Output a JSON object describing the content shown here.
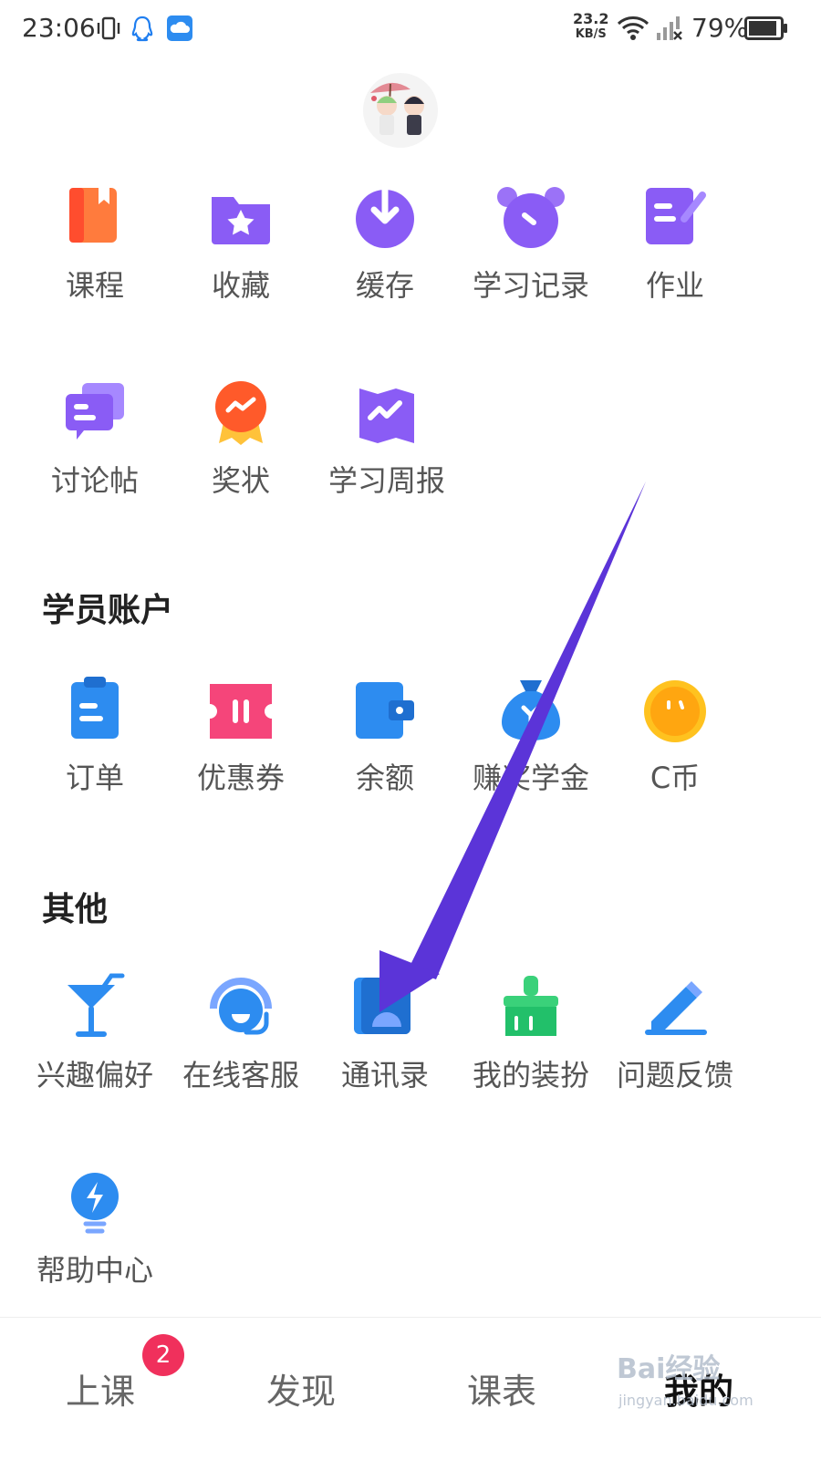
{
  "status_bar": {
    "time": "23:06",
    "speed_value": "23.2",
    "speed_unit": "KB/S",
    "battery": "79%"
  },
  "features": [
    {
      "label": "课程",
      "icon": "course-book-icon"
    },
    {
      "label": "收藏",
      "icon": "favorites-folder-icon"
    },
    {
      "label": "缓存",
      "icon": "cache-download-icon"
    },
    {
      "label": "学习记录",
      "icon": "study-record-clock-icon"
    },
    {
      "label": "作业",
      "icon": "homework-edit-icon"
    },
    {
      "label": "讨论帖",
      "icon": "discussion-chat-icon"
    },
    {
      "label": "奖状",
      "icon": "certificate-medal-icon"
    },
    {
      "label": "学习周报",
      "icon": "weekly-report-map-icon"
    }
  ],
  "account_section": {
    "title": "学员账户",
    "items": [
      {
        "label": "订单",
        "icon": "order-clipboard-icon"
      },
      {
        "label": "优惠券",
        "icon": "coupon-ticket-icon"
      },
      {
        "label": "余额",
        "icon": "balance-wallet-icon"
      },
      {
        "label": "赚奖学金",
        "icon": "scholarship-bag-icon"
      },
      {
        "label": "C币",
        "icon": "c-coin-icon"
      }
    ]
  },
  "other_section": {
    "title": "其他",
    "items": [
      {
        "label": "兴趣偏好",
        "icon": "interest-cocktail-icon"
      },
      {
        "label": "在线客服",
        "icon": "customer-service-headset-icon"
      },
      {
        "label": "通讯录",
        "icon": "contacts-book-icon"
      },
      {
        "label": "我的装扮",
        "icon": "dress-up-brush-icon"
      },
      {
        "label": "问题反馈",
        "icon": "feedback-pencil-icon"
      },
      {
        "label": "帮助中心",
        "icon": "help-bulb-icon"
      }
    ]
  },
  "tabbar": {
    "tabs": [
      {
        "label": "上课",
        "badge": "2"
      },
      {
        "label": "发现"
      },
      {
        "label": "课表"
      },
      {
        "label": "我的",
        "active": true
      }
    ]
  },
  "watermark": {
    "text": "Bai经验",
    "url": "jingyan.baidu.com"
  },
  "colors": {
    "accent": "#7b4dff",
    "badge": "#f0305c",
    "arrow": "#5b34d8"
  }
}
